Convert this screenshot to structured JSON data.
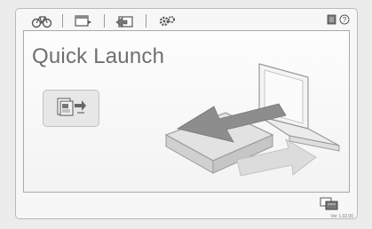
{
  "app": {
    "title": "Quick Launch",
    "version": "Ver 1.02.00"
  },
  "toolbar": {
    "tabs": [
      {
        "icon": "bike-icon"
      },
      {
        "icon": "window-screen-icon"
      },
      {
        "icon": "export-icon"
      },
      {
        "icon": "gears-icon"
      }
    ],
    "right_icons": [
      "manual-icon",
      "help-icon"
    ],
    "help_glyph": "?"
  },
  "main": {
    "launch_button_icon": "document-transfer-icon",
    "illustration": "external-drive-to-laptop-icon"
  },
  "footer": {
    "icon": "screens-icon"
  }
}
